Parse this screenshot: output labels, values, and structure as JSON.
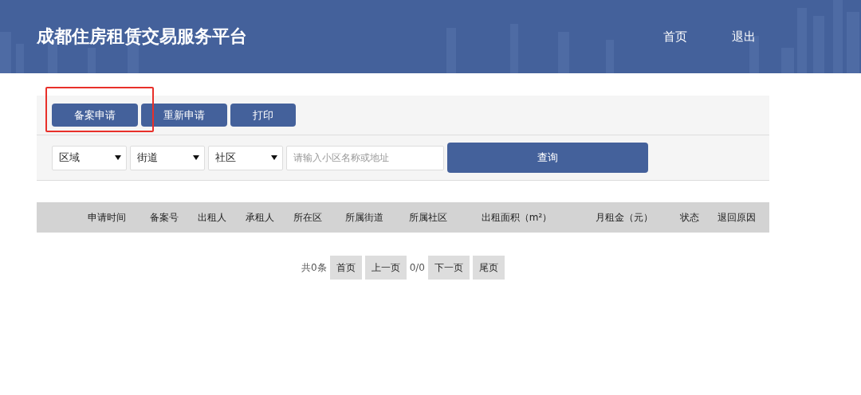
{
  "header": {
    "title": "成都住房租赁交易服务平台",
    "nav": [
      "首页",
      "退出"
    ]
  },
  "toolbar": {
    "buttons": [
      {
        "label": "备案申请",
        "highlighted": true
      },
      {
        "label": "重新申请",
        "highlighted": false
      },
      {
        "label": "打印",
        "highlighted": false
      }
    ]
  },
  "filters": {
    "selects": [
      "区域",
      "街道",
      "社区"
    ],
    "search": {
      "placeholder": "请输入小区名称或地址"
    },
    "query_button": "查询"
  },
  "table": {
    "columns": [
      "申请时间",
      "备案号",
      "出租人",
      "承租人",
      "所在区",
      "所属街道",
      "所属社区",
      "出租面积（m²）",
      "月租金（元）",
      "状态",
      "退回原因"
    ]
  },
  "pagination": {
    "total": "共0条",
    "first": "首页",
    "prev": "上一页",
    "page": "0/0",
    "next": "下一页",
    "last": "尾页"
  }
}
